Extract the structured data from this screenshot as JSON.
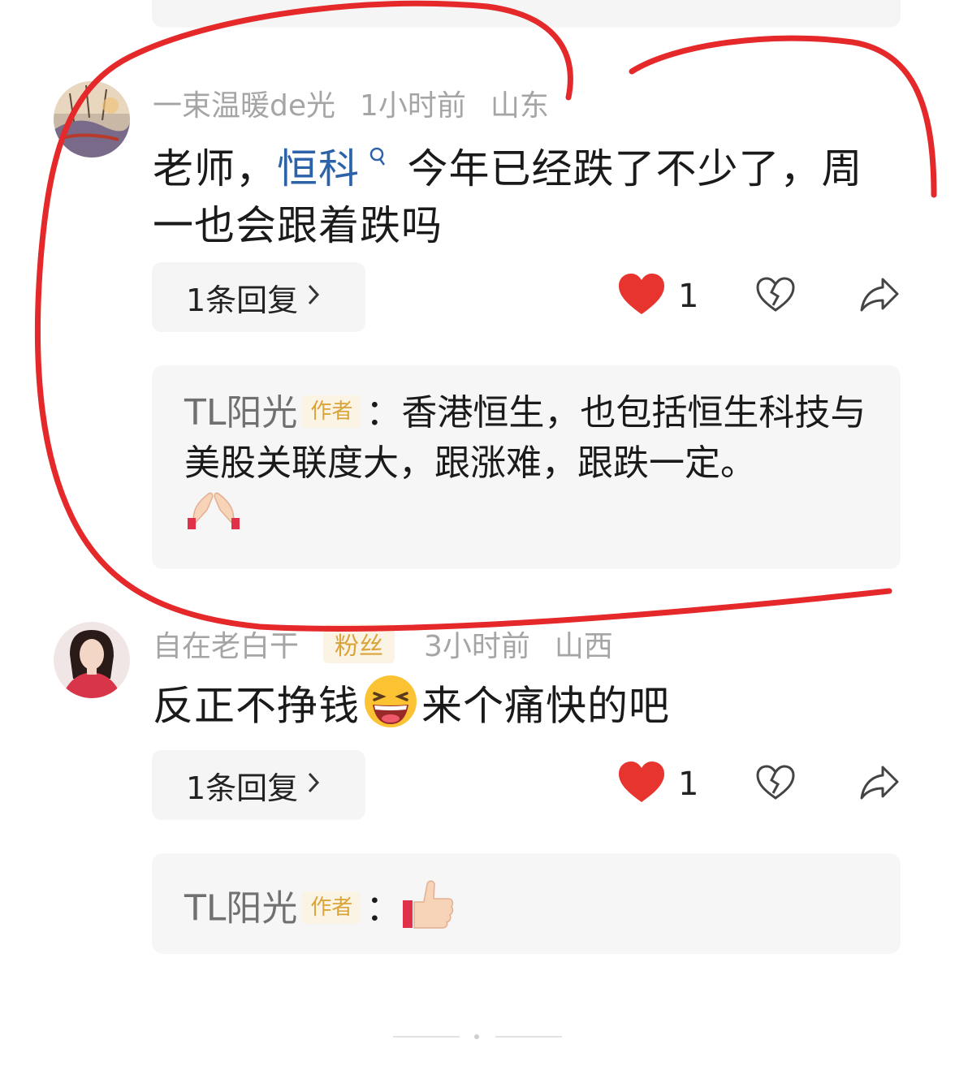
{
  "comments": [
    {
      "username": "一束温暖de光",
      "time": "1小时前",
      "location": "山东",
      "text_before": "老师，",
      "link_term": "恒科",
      "text_after": "今年已经跌了不少了，周一也会跟着跌吗",
      "reply_button": "1条回复",
      "like_count": "1",
      "author_reply": {
        "name": "TL阳光",
        "badge": "作者",
        "separator": "：",
        "text": "香港恒生，也包括恒生科技与美股关联度大，跟涨难，跟跌一定。",
        "emoji": "pray-emoji"
      }
    },
    {
      "username": "自在老白干",
      "badge": "粉丝",
      "time": "3小时前",
      "location": "山西",
      "text_before": "反正不挣钱",
      "text_after": "来个痛快的吧",
      "emoji": "laughing-emoji",
      "reply_button": "1条回复",
      "like_count": "1",
      "author_reply": {
        "name": "TL阳光",
        "badge": "作者",
        "separator": "：",
        "emoji": "thumbs-up-emoji"
      }
    }
  ],
  "colors": {
    "like_heart": "#e8342f",
    "annotation_stroke": "#e5282a",
    "link": "#2c63a8",
    "badge": "#d9a43a"
  },
  "icons": [
    "heart-icon",
    "broken-heart-icon",
    "share-icon",
    "chevron-right-icon",
    "search-icon"
  ]
}
